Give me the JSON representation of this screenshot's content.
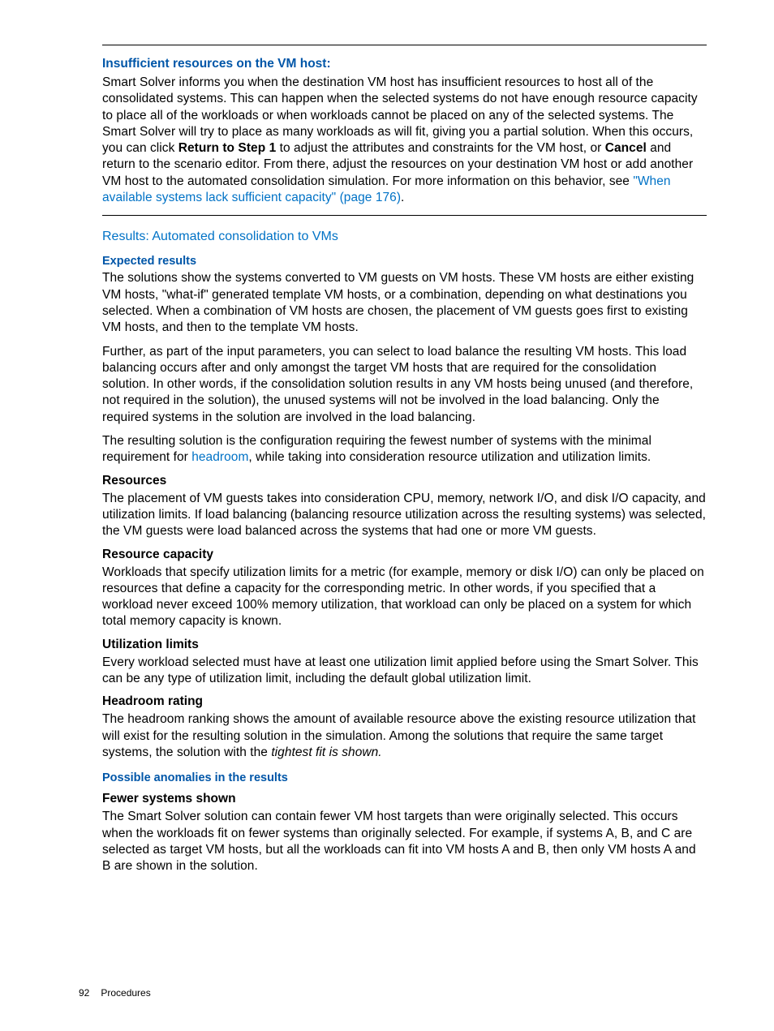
{
  "section_insufficient": {
    "heading": "Insufficient resources on the VM host:",
    "p1a": "Smart Solver informs you when the destination VM host has insufficient resources to host all of the consolidated systems. This can happen when the selected systems do not have enough resource capacity to place all of the workloads or when workloads cannot be placed on any of the selected systems. The Smart Solver will try to place as many workloads as will fit, giving you a partial solution. When this occurs, you can click ",
    "return_step": "Return to Step 1",
    "p1b": " to adjust the attributes and constraints for the VM host, or ",
    "cancel": "Cancel",
    "p1c": " and return to the scenario editor. From there, adjust the resources on your destination VM host or add another VM host to the automated consolidation simulation. For more information on this behavior, see ",
    "link_text": "\"When available systems lack sufficient capacity\" (page 176)",
    "period": "."
  },
  "section_results": {
    "heading": "Results: Automated consolidation to VMs",
    "expected_heading": "Expected results",
    "expected_p1": "The solutions show the systems converted to VM guests on VM hosts. These VM hosts are either existing VM hosts, \"what-if\" generated template VM hosts, or a combination, depending on what destinations you selected. When a combination of VM hosts are chosen, the placement of VM guests goes first to existing VM hosts, and then to the template VM hosts.",
    "expected_p2": "Further, as part of the input parameters, you can select to load balance the resulting VM hosts. This load balancing occurs after and only amongst the target VM hosts that are required for the consolidation solution. In other words, if the consolidation solution results in any VM hosts being unused (and therefore, not required in the solution), the unused systems will not be involved in the load balancing. Only the required systems in the solution are involved in the load balancing.",
    "expected_p3a": "The resulting solution is the configuration requiring the fewest number of systems with the minimal requirement for ",
    "headroom_link": "headroom",
    "expected_p3b": ", while taking into consideration resource utilization and utilization limits.",
    "resources_heading": "Resources",
    "resources_p1": "The placement of VM guests takes into consideration CPU, memory, network I/O, and disk I/O capacity, and utilization limits. If load balancing (balancing resource utilization across the resulting systems) was selected, the VM guests were load balanced across the systems that had one or more VM guests.",
    "capacity_heading": "Resource capacity",
    "capacity_p1": "Workloads that specify utilization limits for a metric (for example, memory or disk I/O) can only be placed on resources that define a capacity for the corresponding metric. In other words, if you specified that a workload never exceed 100% memory utilization, that workload can only be placed on a system for which total memory capacity is known.",
    "utilization_heading": "Utilization limits",
    "utilization_p1": "Every workload selected must have at least one utilization limit applied before using the Smart Solver. This can be any type of utilization limit, including the default global utilization limit.",
    "headroom_heading": "Headroom rating",
    "headroom_p1a": "The headroom ranking shows the amount of available resource above the existing resource utilization that will exist for the resulting solution in the simulation. Among the solutions that require the same target systems, the solution with the ",
    "tightest_fit": "tightest fit is shown.",
    "anomalies_heading": "Possible anomalies in the results",
    "fewer_heading": "Fewer systems shown",
    "fewer_p1": "The Smart Solver solution can contain fewer VM host targets than were originally selected. This occurs when the workloads fit on fewer systems than originally selected. For example, if systems A, B, and C are selected as target VM hosts, but all the workloads can fit into VM hosts A and B, then only VM hosts A and B are shown in the solution."
  },
  "footer": {
    "page_number": "92",
    "section": "Procedures"
  }
}
